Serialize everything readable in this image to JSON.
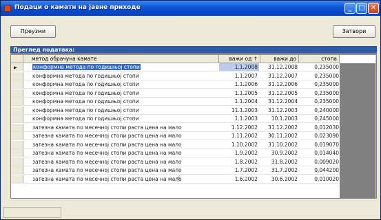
{
  "window": {
    "title": "Подаци о каматн на јавне приходе"
  },
  "toolbar": {
    "left_button": "Преузми",
    "right_button": "Затвори"
  },
  "section": {
    "header": "Преглед података:"
  },
  "grid": {
    "columns": {
      "method": "метод обрачуна камате",
      "from": "важи од",
      "to": "важи до",
      "rate": "стопа"
    },
    "rows": [
      {
        "method": "конформна метода по годишњој стопи",
        "from": "1.1.2008",
        "to": "31.12.2008",
        "rate": "0,235000"
      },
      {
        "method": "конформна метода по годишњој стопи",
        "from": "1.1.2007",
        "to": "31.12.2007",
        "rate": "0,235000"
      },
      {
        "method": "конформна метода по годишњој стопи",
        "from": "1.1.2006",
        "to": "31.12.2006",
        "rate": "0,235000"
      },
      {
        "method": "конформна метода по годишњој стопи",
        "from": "1.1.2005",
        "to": "31.12.2005",
        "rate": "0,235000"
      },
      {
        "method": "конформна метода по годишњој стопи",
        "from": "1.1.2004",
        "to": "31.12.2004",
        "rate": "0,235000"
      },
      {
        "method": "конформна метода по годишњој стопи",
        "from": "11.1.2003",
        "to": "31.12.2003",
        "rate": "0,240000"
      },
      {
        "method": "конформна метода по годишњој стопи",
        "from": "1.1.2003",
        "to": "10.1.2003",
        "rate": "0,245000"
      },
      {
        "method": "затезна камата по месечној стопи раста цена на мало",
        "from": "1.12.2002",
        "to": "31.12.2002",
        "rate": "0,012030"
      },
      {
        "method": "затезна камата по месечној стопи раста цена на мало",
        "from": "1.11.2002",
        "to": "30.11.2002",
        "rate": "0,023090"
      },
      {
        "method": "затезна камата по месечној стопи раста цена на мало",
        "from": "1.10.2002",
        "to": "31.10.2002",
        "rate": "0,019070"
      },
      {
        "method": "затезна камата по месечној стопи раста цена на мало",
        "from": "1.9.2002",
        "to": "30.9.2002",
        "rate": "0,014040"
      },
      {
        "method": "затезна камата по месечној стопи раста цена на мало",
        "from": "1.8.2002",
        "to": "31.8.2002",
        "rate": "0,009020"
      },
      {
        "method": "затезна камата по месечној стопи раста цена на мало",
        "from": "1.7.2002",
        "to": "31.7.2002",
        "rate": "0,044200"
      },
      {
        "method": "затезна камата по месечној стопи раста цена на мало",
        "from": "1.6.2002",
        "to": "30.6.2002",
        "rate": "0,010020"
      }
    ]
  },
  "glyphs": {
    "sort_asc": "↑",
    "row_pointer": "▶",
    "minimize": "_",
    "maximize": "□",
    "close": "✕",
    "scroll_up": "▲",
    "scroll_down": "▼"
  },
  "colors": {
    "titlebar": "#0a53d6",
    "selection": "#316ac5",
    "section_header": "#2f5aa8"
  }
}
